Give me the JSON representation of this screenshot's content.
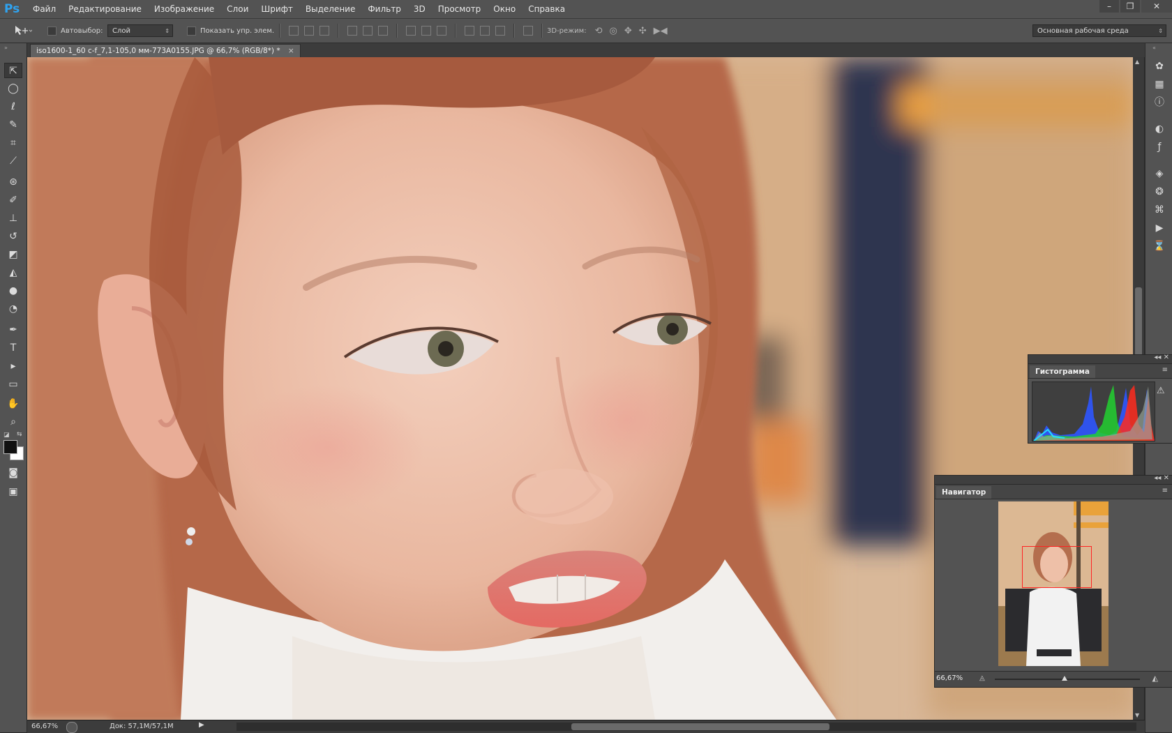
{
  "app": {
    "logo": "Ps"
  },
  "menu": [
    "Файл",
    "Редактирование",
    "Изображение",
    "Слои",
    "Шрифт",
    "Выделение",
    "Фильтр",
    "3D",
    "Просмотр",
    "Окно",
    "Справка"
  ],
  "window_controls": {
    "minimize": "–",
    "restore": "❐",
    "close": "✕"
  },
  "options": {
    "autoselect_label": "Автовыбор:",
    "autoselect_target": "Слой",
    "show_controls_label": "Показать упр. элем.",
    "mode_3d_label": "3D-режим:",
    "workspace": "Основная рабочая среда"
  },
  "document": {
    "tab_title": "iso1600-1_60 c-f_7,1-105,0 мм-773A0155.JPG @ 66,7% (RGB/8*) *",
    "close": "×"
  },
  "status": {
    "zoom": "66,67%",
    "doc_info": "Док: 57,1M/57,1M"
  },
  "panels": {
    "histogram": {
      "title": "Гистограмма",
      "warning_icon": "warning-icon"
    },
    "navigator": {
      "title": "Навигатор",
      "zoom": "66,67%"
    }
  },
  "tools": [
    "move",
    "rect-marquee",
    "lasso",
    "quick-select",
    "crop",
    "eyedropper",
    "spot-heal",
    "brush",
    "clone-stamp",
    "history-brush",
    "eraser",
    "paint-bucket",
    "blur",
    "dodge",
    "pen",
    "type",
    "path-select",
    "rectangle",
    "hand",
    "zoom"
  ],
  "colors": {
    "accent": "#2fa3f0",
    "ui_bg": "#535353",
    "canvas_bg": "#282828",
    "nav_frame": "#ff2222"
  }
}
